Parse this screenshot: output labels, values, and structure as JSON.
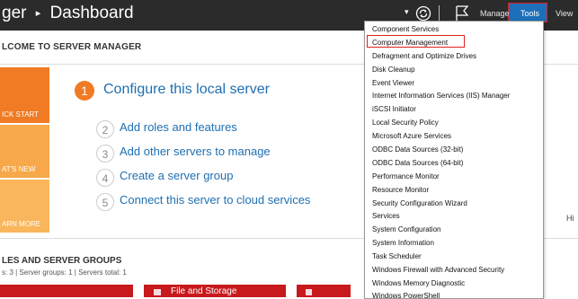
{
  "header": {
    "title_partial": "ger",
    "breadcrumb_current": "Dashboard",
    "breadcrumb_separator": "▸",
    "caret_glyph": "▾",
    "menu": {
      "manage": "Manage",
      "tools": "Tools",
      "view": "View"
    }
  },
  "welcome": {
    "heading": "LCOME TO SERVER MANAGER"
  },
  "tiles": [
    {
      "label": "ICK START",
      "color": "#f07b24"
    },
    {
      "label": "AT'S NEW",
      "color": "#f7a84a"
    },
    {
      "label": "ARN MORE",
      "color": "#f9b65c"
    }
  ],
  "steps": [
    {
      "number": "1",
      "label": "Configure this local server"
    },
    {
      "number": "2",
      "label": "Add roles and features"
    },
    {
      "number": "3",
      "label": "Add other servers to manage"
    },
    {
      "number": "4",
      "label": "Create a server group"
    },
    {
      "number": "5",
      "label": "Connect this server to cloud services"
    }
  ],
  "right_edge_label": "Hi",
  "roles": {
    "heading": "LES AND SERVER GROUPS",
    "subtext": "s: 3   |   Server groups: 1   |   Servers total: 1"
  },
  "bottom_tiles": {
    "file_storage": "File and Storage"
  },
  "tools_menu": {
    "items": [
      "Component Services",
      "Computer Management",
      "Defragment and Optimize Drives",
      "Disk Cleanup",
      "Event Viewer",
      "Internet Information Services (IIS) Manager",
      "iSCSI Initiator",
      "Local Security Policy",
      "Microsoft Azure Services",
      "ODBC Data Sources (32-bit)",
      "ODBC Data Sources (64-bit)",
      "Performance Monitor",
      "Resource Monitor",
      "Security Configuration Wizard",
      "Services",
      "System Configuration",
      "System Information",
      "Task Scheduler",
      "Windows Firewall with Advanced Security",
      "Windows Memory Diagnostic",
      "Windows PowerShell"
    ],
    "highlighted": "Computer Management"
  },
  "colors": {
    "header_bg": "#2b2b2b",
    "accent_orange": "#f07b24",
    "link_blue": "#1f6fb2",
    "tools_active": "#1c6fb8",
    "highlight_red": "#e02020",
    "tile_red": "#c8191c"
  }
}
